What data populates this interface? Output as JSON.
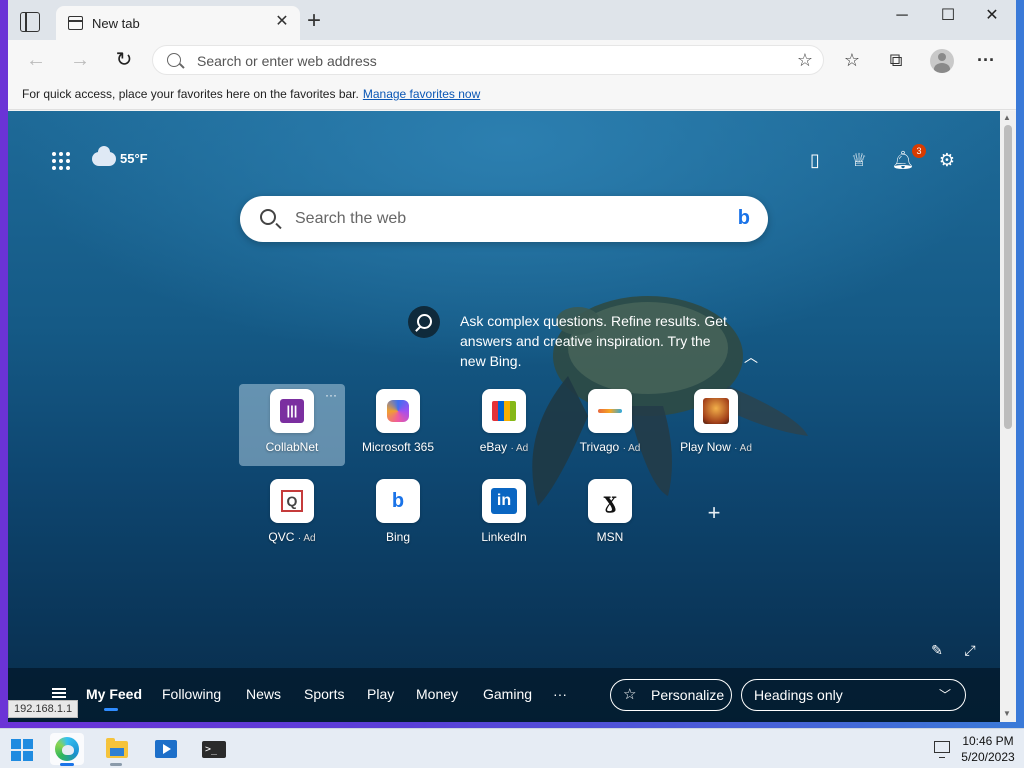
{
  "tab": {
    "title": "New tab",
    "close": "✕"
  },
  "window_controls": {
    "minimize": "─",
    "maximize": "☐",
    "close": "✕"
  },
  "toolbar": {
    "back": "←",
    "forward": "→",
    "refresh": "↻",
    "address_placeholder": "Search or enter web address",
    "more": "···"
  },
  "favbar": {
    "message": "For quick access, place your favorites here on the favorites bar.",
    "link": "Manage favorites now"
  },
  "weather": {
    "temp": "55°F"
  },
  "notifications": {
    "count": "3"
  },
  "search": {
    "placeholder": "Search the web",
    "brand": "b"
  },
  "promo": {
    "text": "Ask complex questions. Refine results. Get answers and creative inspiration. Try the new Bing."
  },
  "quick_links": [
    {
      "label": "CollabNet",
      "ad": ""
    },
    {
      "label": "Microsoft 365",
      "ad": ""
    },
    {
      "label": "eBay",
      "ad": "· Ad"
    },
    {
      "label": "Trivago",
      "ad": "· Ad"
    },
    {
      "label": "Play Now",
      "ad": "· Ad"
    },
    {
      "label": "QVC",
      "ad": "· Ad"
    },
    {
      "label": "Bing",
      "ad": ""
    },
    {
      "label": "LinkedIn",
      "ad": ""
    },
    {
      "label": "MSN",
      "ad": ""
    }
  ],
  "feed_tabs": [
    "My Feed",
    "Following",
    "News",
    "Sports",
    "Play",
    "Money",
    "Gaming",
    "···"
  ],
  "personalize": "Personalize",
  "headings": "Headings only",
  "status_url": "192.168.1.1",
  "clock": {
    "time": "10:46 PM",
    "date": "5/20/2023"
  },
  "colors": {
    "feed_active": "#2f8cff",
    "badge": "#d83b01",
    "accent": "#1a73e8"
  }
}
